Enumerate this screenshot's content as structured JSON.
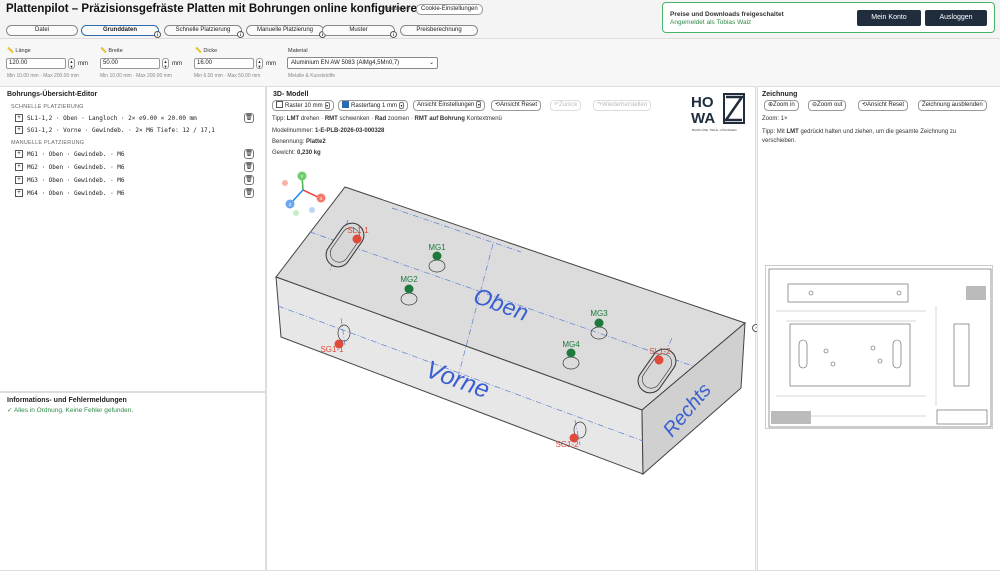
{
  "header": {
    "title": "Plattenpilot – Präzisionsgefräste Platten mit Bohrungen online konfigurieren",
    "version": "Version 1.0",
    "cookie_button": "Cookie-Einstellungen",
    "tabs": [
      {
        "label": "Datei",
        "info": false
      },
      {
        "label": "Grunddaten",
        "info": true,
        "active": true
      },
      {
        "label": "Schnelle Platzierung",
        "info": true
      },
      {
        "label": "Manuelle Platzierung",
        "info": true
      },
      {
        "label": "Muster",
        "info": true
      },
      {
        "label": "Preisberechnung",
        "info": false
      }
    ]
  },
  "account": {
    "notice_title": "Preise und Downloads freigeschaltet",
    "notice_user": "Angemeldet als Tobias Walz",
    "my_account": "Mein Konto",
    "logout": "Ausloggen",
    "accent": "#48b36a"
  },
  "basics": {
    "length": {
      "label": "Länge",
      "value": "120.00",
      "unit": "mm",
      "hint": "Min 10.00 mm · Max 200.00 mm"
    },
    "width": {
      "label": "Breite",
      "value": "50.00",
      "unit": "mm",
      "hint": "Min 10.00 mm · Max 200.00 mm"
    },
    "thickness": {
      "label": "Dicke",
      "value": "16.00",
      "unit": "mm",
      "hint": "Min 6.00 mm · Max 50.00 mm"
    },
    "material": {
      "label": "Material",
      "value": "Aluminium EN AW 5083 (AlMg4,5Mn0,7)",
      "hint": "Metalle & Kunststoffe"
    }
  },
  "editor": {
    "title": "Bohrungs-Übersicht-Editor",
    "quick_head": "SCHNELLE PLATZIERUNG",
    "quick_items": [
      "SL1-1,2 · Oben · Langloch · 2× ⌀9.00 × 20.00 mm",
      "SG1-1,2 · Vorne · Gewindeb. · 2× M6 Tiefe: 12 / 17,1"
    ],
    "manual_head": "MANUELLE PLATZIERUNG",
    "manual_items": [
      "MG1 · Oben · Gewindeb. · M6",
      "MG2 · Oben · Gewindeb. · M6",
      "MG3 · Oben · Gewindeb. · M6",
      "MG4 · Oben · Gewindeb. · M6"
    ]
  },
  "messages": {
    "title": "Informations- und Fehlermeldungen",
    "status": "✓ Alles in Ordnung. Keine Fehler gefunden."
  },
  "viewer": {
    "title": "3D- Modell",
    "raster": "Raster 10 mm",
    "snap": "Rasterfang 1 mm",
    "view_settings": "Ansicht Einstellungen",
    "view_reset": "Ansicht Reset",
    "undo": "Zurück",
    "redo": "Wiederherstellen",
    "tip_parts": [
      "Tipp: ",
      "LMT",
      " drehen · ",
      "RMT",
      " schwenken · ",
      "Rad",
      " zoomen · ",
      "RMT auf Bohrung",
      " Kontextmenü"
    ],
    "model_label": "Modellnummer: ",
    "model_value": "1-E-PLB-2026-03-000328",
    "name_label": "Benennung: ",
    "name_value": "Platte2",
    "weight_label": "Gewicht: ",
    "weight_value": "0,230 kg",
    "face_top": "Oben",
    "face_front": "Vorne",
    "face_right": "Rechts",
    "holes": {
      "SL1-1": "SL1-1",
      "SL1-2": "SL1-2",
      "MG1": "MG1",
      "MG2": "MG2",
      "MG3": "MG3",
      "MG4": "MG4",
      "SG1-1": "SG1-1",
      "SG1-2": "SG1-2"
    },
    "axes": {
      "x": "X",
      "y": "Y",
      "z": "Z"
    },
    "colors": {
      "red_hole": "#e04a3a",
      "green_hole": "#1e7a3c",
      "face_text": "#3a5fd0"
    }
  },
  "logo": {
    "line1": "HO",
    "line2": "WA",
    "tagline": "BAUPLÄNE. TEILE. LÖSUNGEN."
  },
  "drawing": {
    "title": "Zeichnung",
    "zoom_in": "Zoom in",
    "zoom_out": "Zoom out",
    "reset": "Ansicht Reset",
    "hide": "Zeichnung ausblenden",
    "zoom_level": "Zoom: 1×",
    "tip_prefix": "Tipp: Mit ",
    "tip_key": "LMT",
    "tip_suffix": " gedrückt halten und ziehen, um die gesamte Zeichnung zu verschieben."
  }
}
